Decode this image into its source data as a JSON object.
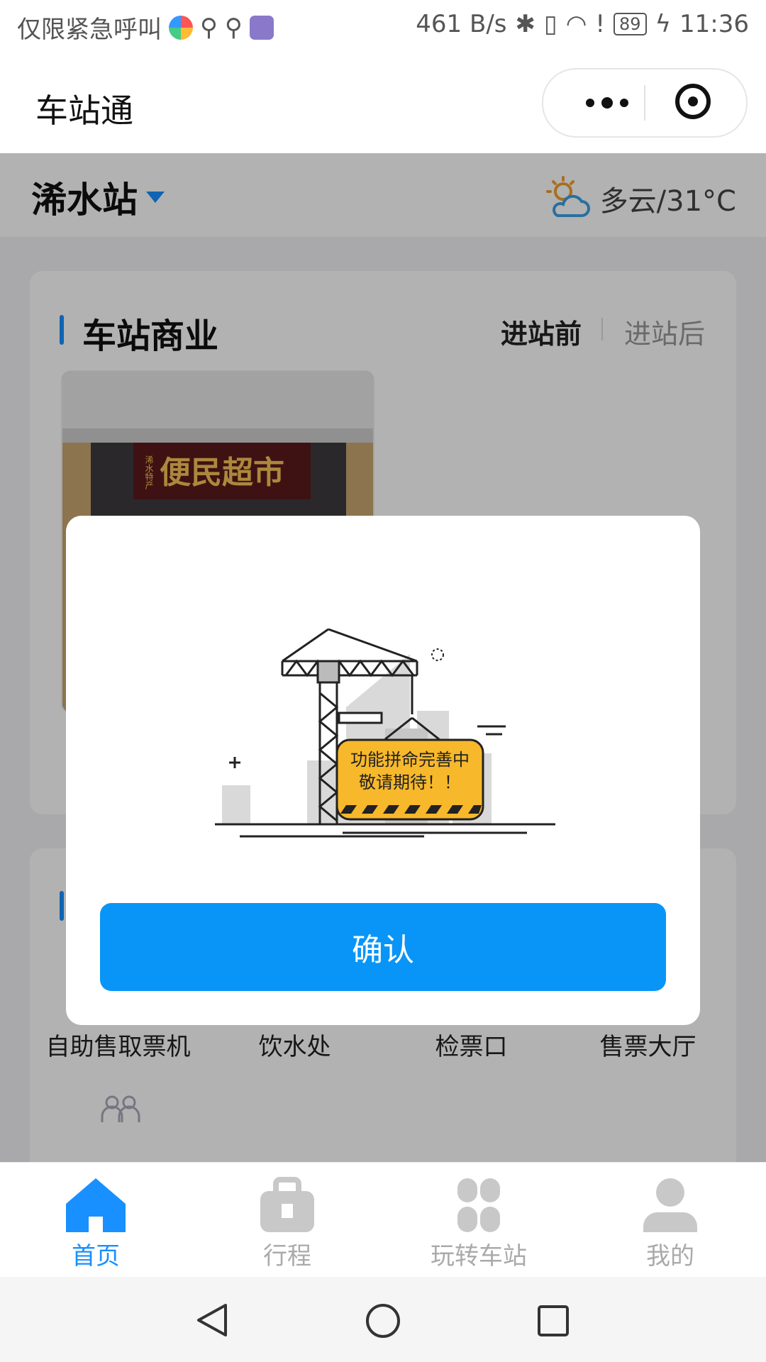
{
  "status_bar": {
    "carrier_text": "仅限紧急呼叫",
    "network_speed": "461 B/s",
    "battery": "89",
    "time": "11:36"
  },
  "title_bar": {
    "title": "车站通",
    "more_icon": "more-dots-icon",
    "close_icon": "target-icon"
  },
  "station": {
    "name": "浠水站",
    "weather": "多云/31°C",
    "weather_icon": "partly-cloudy-icon"
  },
  "commerce": {
    "title": "车站商业",
    "tabs": [
      {
        "label": "进站前",
        "active": true
      },
      {
        "label": "进站后",
        "active": false
      }
    ],
    "shop_sign": "便民超市",
    "shop_sign_side": "浠水特产"
  },
  "facilities": {
    "items": [
      {
        "label": "自助售取票机"
      },
      {
        "label": "饮水处"
      },
      {
        "label": "检票口"
      },
      {
        "label": "售票大厅"
      }
    ]
  },
  "modal": {
    "message_line1": "功能拼命完善中",
    "message_line2": "敬请期待！！",
    "confirm_label": "确认"
  },
  "tabbar": {
    "items": [
      {
        "label": "首页",
        "icon": "home-icon",
        "active": true
      },
      {
        "label": "行程",
        "icon": "briefcase-icon",
        "active": false
      },
      {
        "label": "玩转车站",
        "icon": "clover-icon",
        "active": false
      },
      {
        "label": "我的",
        "icon": "user-icon",
        "active": false
      }
    ]
  },
  "colors": {
    "accent": "#1890ff",
    "confirm_button": "#0895f7",
    "sign_yellow": "#f7b82b"
  }
}
